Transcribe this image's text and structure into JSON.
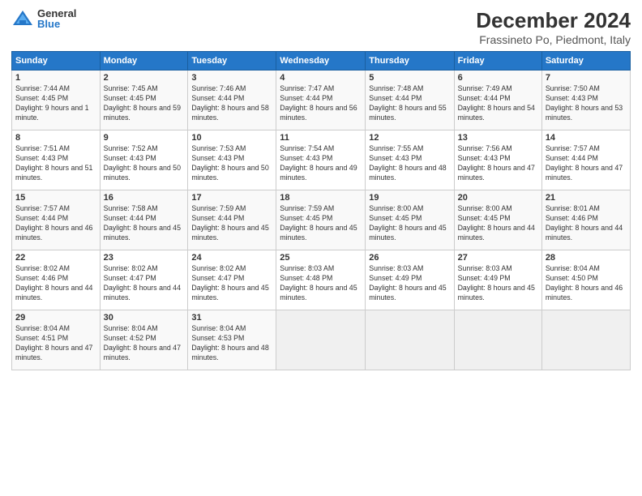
{
  "header": {
    "logo_general": "General",
    "logo_blue": "Blue",
    "month_title": "December 2024",
    "location": "Frassineto Po, Piedmont, Italy"
  },
  "days_of_week": [
    "Sunday",
    "Monday",
    "Tuesday",
    "Wednesday",
    "Thursday",
    "Friday",
    "Saturday"
  ],
  "weeks": [
    [
      {
        "day": "1",
        "sunrise": "Sunrise: 7:44 AM",
        "sunset": "Sunset: 4:45 PM",
        "daylight": "Daylight: 9 hours and 1 minute."
      },
      {
        "day": "2",
        "sunrise": "Sunrise: 7:45 AM",
        "sunset": "Sunset: 4:45 PM",
        "daylight": "Daylight: 8 hours and 59 minutes."
      },
      {
        "day": "3",
        "sunrise": "Sunrise: 7:46 AM",
        "sunset": "Sunset: 4:44 PM",
        "daylight": "Daylight: 8 hours and 58 minutes."
      },
      {
        "day": "4",
        "sunrise": "Sunrise: 7:47 AM",
        "sunset": "Sunset: 4:44 PM",
        "daylight": "Daylight: 8 hours and 56 minutes."
      },
      {
        "day": "5",
        "sunrise": "Sunrise: 7:48 AM",
        "sunset": "Sunset: 4:44 PM",
        "daylight": "Daylight: 8 hours and 55 minutes."
      },
      {
        "day": "6",
        "sunrise": "Sunrise: 7:49 AM",
        "sunset": "Sunset: 4:44 PM",
        "daylight": "Daylight: 8 hours and 54 minutes."
      },
      {
        "day": "7",
        "sunrise": "Sunrise: 7:50 AM",
        "sunset": "Sunset: 4:43 PM",
        "daylight": "Daylight: 8 hours and 53 minutes."
      }
    ],
    [
      {
        "day": "8",
        "sunrise": "Sunrise: 7:51 AM",
        "sunset": "Sunset: 4:43 PM",
        "daylight": "Daylight: 8 hours and 51 minutes."
      },
      {
        "day": "9",
        "sunrise": "Sunrise: 7:52 AM",
        "sunset": "Sunset: 4:43 PM",
        "daylight": "Daylight: 8 hours and 50 minutes."
      },
      {
        "day": "10",
        "sunrise": "Sunrise: 7:53 AM",
        "sunset": "Sunset: 4:43 PM",
        "daylight": "Daylight: 8 hours and 50 minutes."
      },
      {
        "day": "11",
        "sunrise": "Sunrise: 7:54 AM",
        "sunset": "Sunset: 4:43 PM",
        "daylight": "Daylight: 8 hours and 49 minutes."
      },
      {
        "day": "12",
        "sunrise": "Sunrise: 7:55 AM",
        "sunset": "Sunset: 4:43 PM",
        "daylight": "Daylight: 8 hours and 48 minutes."
      },
      {
        "day": "13",
        "sunrise": "Sunrise: 7:56 AM",
        "sunset": "Sunset: 4:43 PM",
        "daylight": "Daylight: 8 hours and 47 minutes."
      },
      {
        "day": "14",
        "sunrise": "Sunrise: 7:57 AM",
        "sunset": "Sunset: 4:44 PM",
        "daylight": "Daylight: 8 hours and 47 minutes."
      }
    ],
    [
      {
        "day": "15",
        "sunrise": "Sunrise: 7:57 AM",
        "sunset": "Sunset: 4:44 PM",
        "daylight": "Daylight: 8 hours and 46 minutes."
      },
      {
        "day": "16",
        "sunrise": "Sunrise: 7:58 AM",
        "sunset": "Sunset: 4:44 PM",
        "daylight": "Daylight: 8 hours and 45 minutes."
      },
      {
        "day": "17",
        "sunrise": "Sunrise: 7:59 AM",
        "sunset": "Sunset: 4:44 PM",
        "daylight": "Daylight: 8 hours and 45 minutes."
      },
      {
        "day": "18",
        "sunrise": "Sunrise: 7:59 AM",
        "sunset": "Sunset: 4:45 PM",
        "daylight": "Daylight: 8 hours and 45 minutes."
      },
      {
        "day": "19",
        "sunrise": "Sunrise: 8:00 AM",
        "sunset": "Sunset: 4:45 PM",
        "daylight": "Daylight: 8 hours and 45 minutes."
      },
      {
        "day": "20",
        "sunrise": "Sunrise: 8:00 AM",
        "sunset": "Sunset: 4:45 PM",
        "daylight": "Daylight: 8 hours and 44 minutes."
      },
      {
        "day": "21",
        "sunrise": "Sunrise: 8:01 AM",
        "sunset": "Sunset: 4:46 PM",
        "daylight": "Daylight: 8 hours and 44 minutes."
      }
    ],
    [
      {
        "day": "22",
        "sunrise": "Sunrise: 8:02 AM",
        "sunset": "Sunset: 4:46 PM",
        "daylight": "Daylight: 8 hours and 44 minutes."
      },
      {
        "day": "23",
        "sunrise": "Sunrise: 8:02 AM",
        "sunset": "Sunset: 4:47 PM",
        "daylight": "Daylight: 8 hours and 44 minutes."
      },
      {
        "day": "24",
        "sunrise": "Sunrise: 8:02 AM",
        "sunset": "Sunset: 4:47 PM",
        "daylight": "Daylight: 8 hours and 45 minutes."
      },
      {
        "day": "25",
        "sunrise": "Sunrise: 8:03 AM",
        "sunset": "Sunset: 4:48 PM",
        "daylight": "Daylight: 8 hours and 45 minutes."
      },
      {
        "day": "26",
        "sunrise": "Sunrise: 8:03 AM",
        "sunset": "Sunset: 4:49 PM",
        "daylight": "Daylight: 8 hours and 45 minutes."
      },
      {
        "day": "27",
        "sunrise": "Sunrise: 8:03 AM",
        "sunset": "Sunset: 4:49 PM",
        "daylight": "Daylight: 8 hours and 45 minutes."
      },
      {
        "day": "28",
        "sunrise": "Sunrise: 8:04 AM",
        "sunset": "Sunset: 4:50 PM",
        "daylight": "Daylight: 8 hours and 46 minutes."
      }
    ],
    [
      {
        "day": "29",
        "sunrise": "Sunrise: 8:04 AM",
        "sunset": "Sunset: 4:51 PM",
        "daylight": "Daylight: 8 hours and 47 minutes."
      },
      {
        "day": "30",
        "sunrise": "Sunrise: 8:04 AM",
        "sunset": "Sunset: 4:52 PM",
        "daylight": "Daylight: 8 hours and 47 minutes."
      },
      {
        "day": "31",
        "sunrise": "Sunrise: 8:04 AM",
        "sunset": "Sunset: 4:53 PM",
        "daylight": "Daylight: 8 hours and 48 minutes."
      },
      null,
      null,
      null,
      null
    ]
  ]
}
